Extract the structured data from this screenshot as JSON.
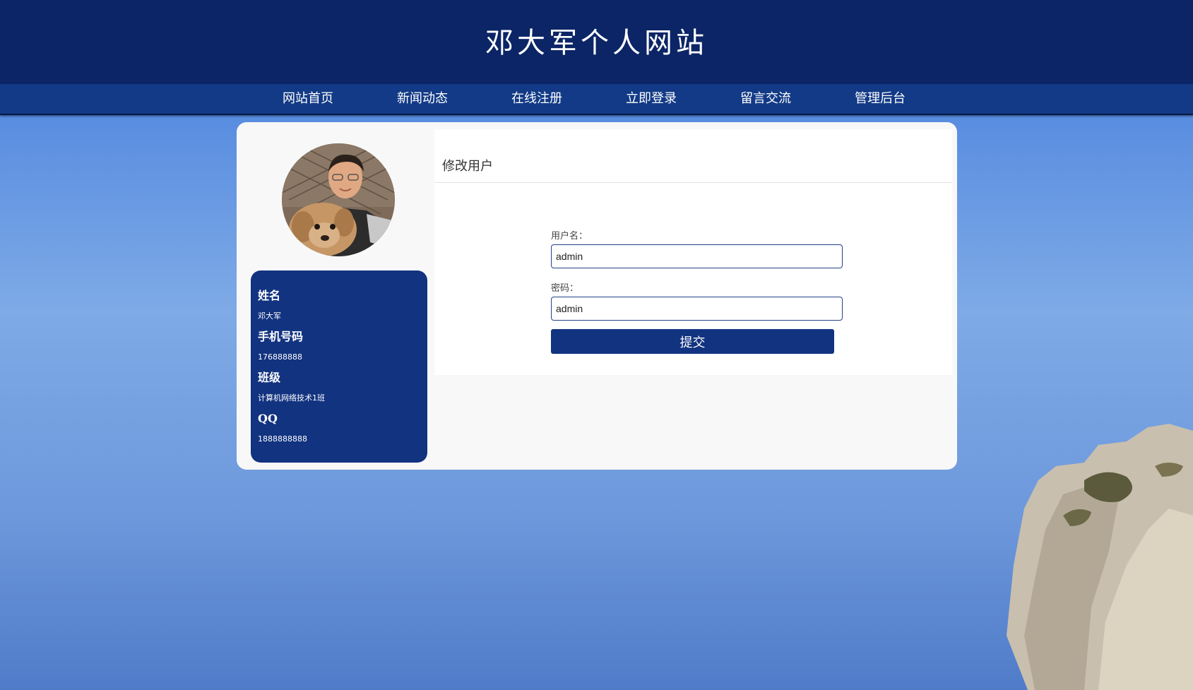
{
  "header": {
    "site_title": "邓大军个人网站"
  },
  "nav": {
    "items": [
      {
        "label": "网站首页"
      },
      {
        "label": "新闻动态"
      },
      {
        "label": "在线注册"
      },
      {
        "label": "立即登录"
      },
      {
        "label": "留言交流"
      },
      {
        "label": "管理后台"
      }
    ]
  },
  "profile": {
    "avatar_icon": "user-photo-with-dog",
    "fields": [
      {
        "label": "姓名",
        "value": "邓大军"
      },
      {
        "label": "手机号码",
        "value": "176888888"
      },
      {
        "label": "班级",
        "value": "计算机网络技术1班"
      },
      {
        "label": "QQ",
        "value": "1888888888"
      }
    ]
  },
  "form": {
    "title": "修改用户",
    "username_label": "用户名：",
    "username_value": "admin",
    "password_label": "密码：",
    "password_value": "admin",
    "submit_label": "提交"
  },
  "colors": {
    "header_bg": "#0b2566",
    "nav_bg": "#123a86",
    "accent": "#123380"
  }
}
